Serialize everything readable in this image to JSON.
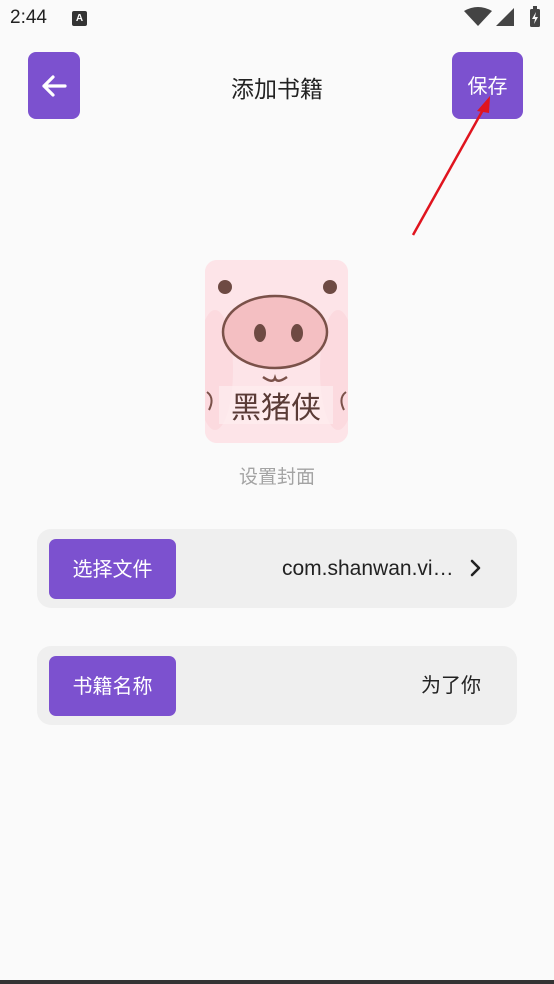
{
  "status_bar": {
    "time": "2:44",
    "a_badge": "A"
  },
  "header": {
    "title": "添加书籍",
    "save_label": "保存",
    "back_icon": "arrow-left-icon"
  },
  "cover": {
    "label": "设置封面",
    "image_text": "黑猪侠"
  },
  "rows": {
    "file": {
      "button_label": "选择文件",
      "value": "com.shanwan.vi…"
    },
    "name": {
      "button_label": "书籍名称",
      "value": "为了你"
    }
  },
  "colors": {
    "accent": "#7c51cf",
    "annotation": "#e0141e",
    "row_bg": "#efefef"
  }
}
